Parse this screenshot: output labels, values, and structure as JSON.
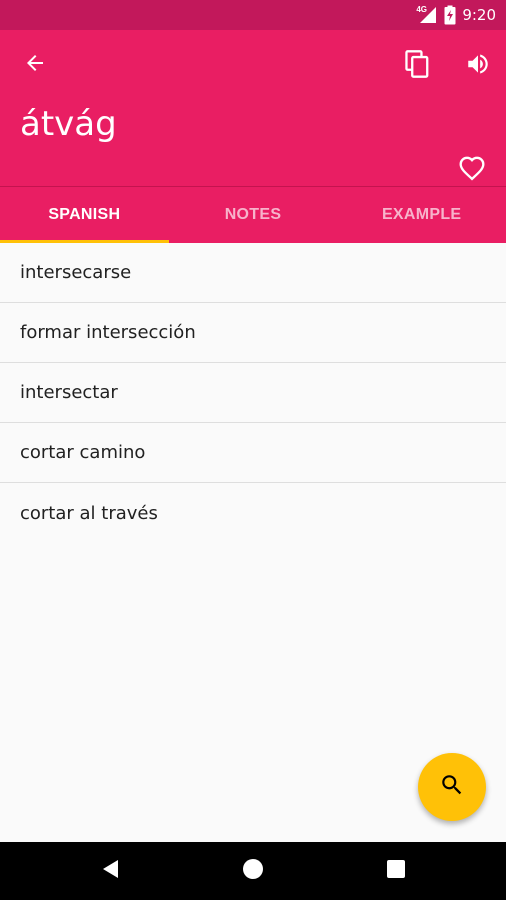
{
  "status_bar": {
    "network_label": "4G",
    "time": "9:20",
    "icons": [
      "signal-icon",
      "battery-charging-icon"
    ]
  },
  "toolbar": {
    "word": "átvág",
    "icons": [
      "arrow-back-icon",
      "copy-icon",
      "volume-icon",
      "heart-outline-icon"
    ]
  },
  "tabs": [
    {
      "label": "SPANISH",
      "active": true
    },
    {
      "label": "NOTES",
      "active": false
    },
    {
      "label": "EXAMPLE",
      "active": false
    }
  ],
  "translations": [
    "intersecarse",
    "formar intersección",
    "intersectar",
    "cortar camino",
    "cortar al través"
  ],
  "fab": {
    "icon": "search-icon"
  },
  "nav_bar": {
    "icons": [
      "nav-back-icon",
      "nav-home-icon",
      "nav-recent-icon"
    ]
  },
  "colors": {
    "primary": "#e91e63",
    "primary_dark": "#c2185b",
    "accent": "#ffc107",
    "background": "#fafafa"
  }
}
